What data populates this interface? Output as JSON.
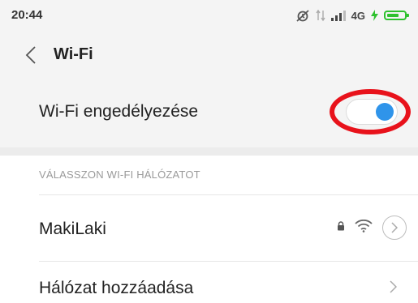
{
  "status_bar": {
    "time": "20:44",
    "network_type": "4G",
    "icons": [
      "alarm-off-icon",
      "data-transfer-icon",
      "signal-bars-icon",
      "battery-charging-icon"
    ],
    "battery_color": "#2ec12e"
  },
  "header": {
    "title": "Wi-Fi",
    "back_icon": "chevron-left-icon"
  },
  "wifi_toggle": {
    "label": "Wi-Fi engedélyezése",
    "enabled": true,
    "knob_color": "#2f94ea",
    "highlight_color": "#e8121b"
  },
  "networks_section": {
    "header": "VÁLASSZON WI-FI HÁLÓZATOT",
    "networks": [
      {
        "name": "MakiLaki",
        "secured": true,
        "icons": [
          "lock-icon",
          "wifi-signal-icon",
          "chevron-right-icon"
        ]
      }
    ]
  },
  "add_network": {
    "label": "Hálózat hozzáadása",
    "icon": "chevron-right-icon"
  }
}
